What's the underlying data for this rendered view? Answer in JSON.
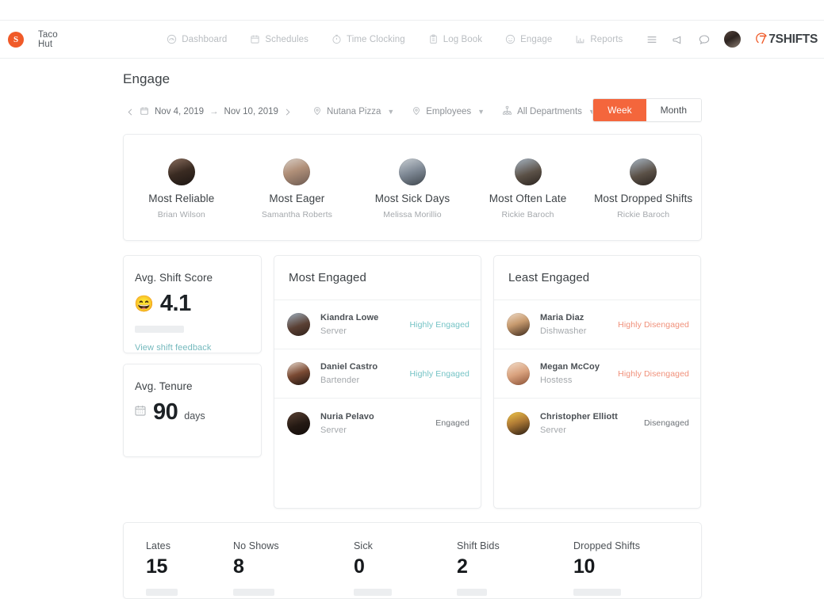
{
  "nav": {
    "brand_name": "Taco Hut",
    "logo_letter": "S",
    "items": [
      {
        "label": "Dashboard",
        "icon": "dashboard-icon"
      },
      {
        "label": "Schedules",
        "icon": "calendar-icon"
      },
      {
        "label": "Time Clocking",
        "icon": "stopwatch-icon"
      },
      {
        "label": "Log Book",
        "icon": "clipboard-icon"
      },
      {
        "label": "Engage",
        "icon": "smiley-icon"
      },
      {
        "label": "Reports",
        "icon": "bar-chart-icon"
      }
    ],
    "right_icons": [
      "hamburger-menu-icon",
      "megaphone-icon",
      "chat-bubble-icon"
    ],
    "wordmark": "7SHIFTS"
  },
  "page": {
    "title": "Engage"
  },
  "filters": {
    "date_start": "Nov 4, 2019",
    "date_separator": "→",
    "date_end": "Nov 10, 2019",
    "location": "Nutana Pizza",
    "employees": "Employees",
    "departments": "All Departments",
    "range_toggle": {
      "options": [
        "Week",
        "Month"
      ],
      "selected": "Week"
    }
  },
  "awards": [
    {
      "title": "Most Reliable",
      "name": "Brian Wilson"
    },
    {
      "title": "Most Eager",
      "name": "Samantha Roberts"
    },
    {
      "title": "Most Sick Days",
      "name": "Melissa Morillio"
    },
    {
      "title": "Most Often Late",
      "name": "Rickie Baroch"
    },
    {
      "title": "Most Dropped Shifts",
      "name": "Rickie Baroch"
    }
  ],
  "shift_score": {
    "title": "Avg. Shift Score",
    "emoji": "😄",
    "value": "4.1",
    "link": "View shift feedback"
  },
  "tenure": {
    "title": "Avg. Tenure",
    "icon": "calendar-icon",
    "value": "90",
    "unit": "days"
  },
  "most_engaged": {
    "title": "Most Engaged",
    "rows": [
      {
        "name": "Kiandra Lowe",
        "role": "Server",
        "tag": "Highly Engaged"
      },
      {
        "name": "Daniel Castro",
        "role": "Bartender",
        "tag": "Highly Engaged"
      },
      {
        "name": "Nuria Pelavo",
        "role": "Server",
        "tag": "Engaged"
      }
    ]
  },
  "least_engaged": {
    "title": "Least Engaged",
    "rows": [
      {
        "name": "Maria Diaz",
        "role": "Dishwasher",
        "tag": "Highly Disengaged"
      },
      {
        "name": "Megan McCoy",
        "role": "Hostess",
        "tag": "Highly Disengaged"
      },
      {
        "name": "Christopher Elliott",
        "role": "Server",
        "tag": "Disengaged"
      }
    ]
  },
  "bottom_stats": [
    {
      "label": "Lates",
      "value": "15"
    },
    {
      "label": "No Shows",
      "value": "8"
    },
    {
      "label": "Sick",
      "value": "0"
    },
    {
      "label": "Shift Bids",
      "value": "2"
    },
    {
      "label": "Dropped Shifts",
      "value": "10"
    }
  ],
  "colors": {
    "brand_orange": "#f05a28",
    "toggle_active": "#f4663c",
    "engaged_teal": "#74c3c5",
    "disengaged_salmon": "#f0907a",
    "link_teal": "#74b9bd",
    "neutral_text": "#8d9196"
  }
}
